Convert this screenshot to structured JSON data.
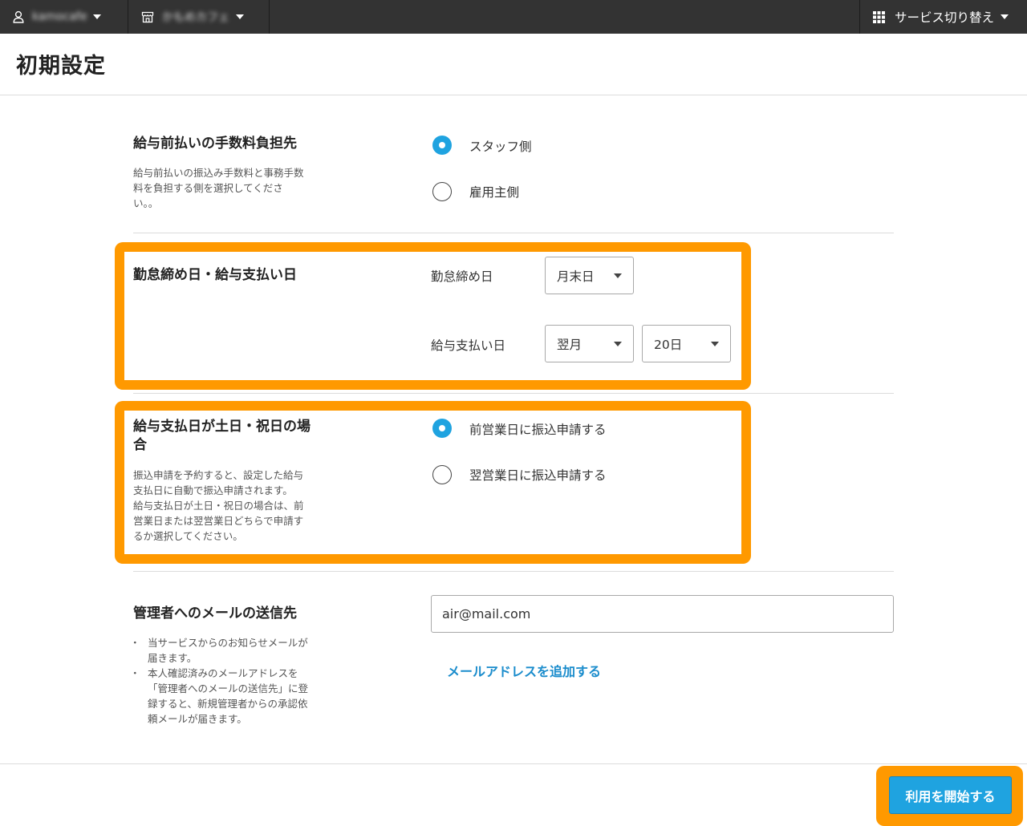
{
  "header": {
    "account_name": "kamocafe",
    "store_name": "かもめカフェ",
    "service_switch_label": "サービス切り替え"
  },
  "page": {
    "title": "初期設定"
  },
  "fee_section": {
    "title": "給与前払いの手数料負担先",
    "description_lines": [
      "給与前払いの振込み手数料と事務手数",
      "料を負担する側を選択してくださ",
      "い。。"
    ],
    "options": [
      {
        "label": "スタッフ側",
        "selected": true
      },
      {
        "label": "雇用主側",
        "selected": false
      }
    ]
  },
  "closing_section": {
    "title": "勤怠締め日・給与支払い日",
    "closing_day_label": "勤怠締め日",
    "closing_day_value": "月末日",
    "payday_label": "給与支払い日",
    "payday_month_value": "翌月",
    "payday_day_value": "20日"
  },
  "holiday_section": {
    "title_lines": [
      "給与支払日が土日・祝日の場",
      "合"
    ],
    "description_lines": [
      "振込申請を予約すると、設定した給与",
      "支払日に自動で振込申請されます。",
      "給与支払日が土日・祝日の場合は、前",
      "営業日または翌営業日どちらで申請す",
      "るか選択してください。"
    ],
    "options": [
      {
        "label": "前営業日に振込申請する",
        "selected": true
      },
      {
        "label": "翌営業日に振込申請する",
        "selected": false
      }
    ]
  },
  "email_section": {
    "title": "管理者へのメールの送信先",
    "notes": [
      [
        "当サービスからのお知らせメールが",
        "届きます。"
      ],
      [
        "本人確認済みのメールアドレスを",
        "「管理者へのメールの送信先」に登",
        "録すると、新規管理者からの承認依",
        "頼メールが届きます。"
      ]
    ],
    "email_value": "air@mail.com",
    "add_email_link": "メールアドレスを追加する"
  },
  "footer": {
    "start_button": "利用を開始する"
  },
  "colors": {
    "accent": "#1fa3e0",
    "highlight": "#ff9900",
    "topbar": "#333333",
    "link": "#1a8ccc"
  }
}
